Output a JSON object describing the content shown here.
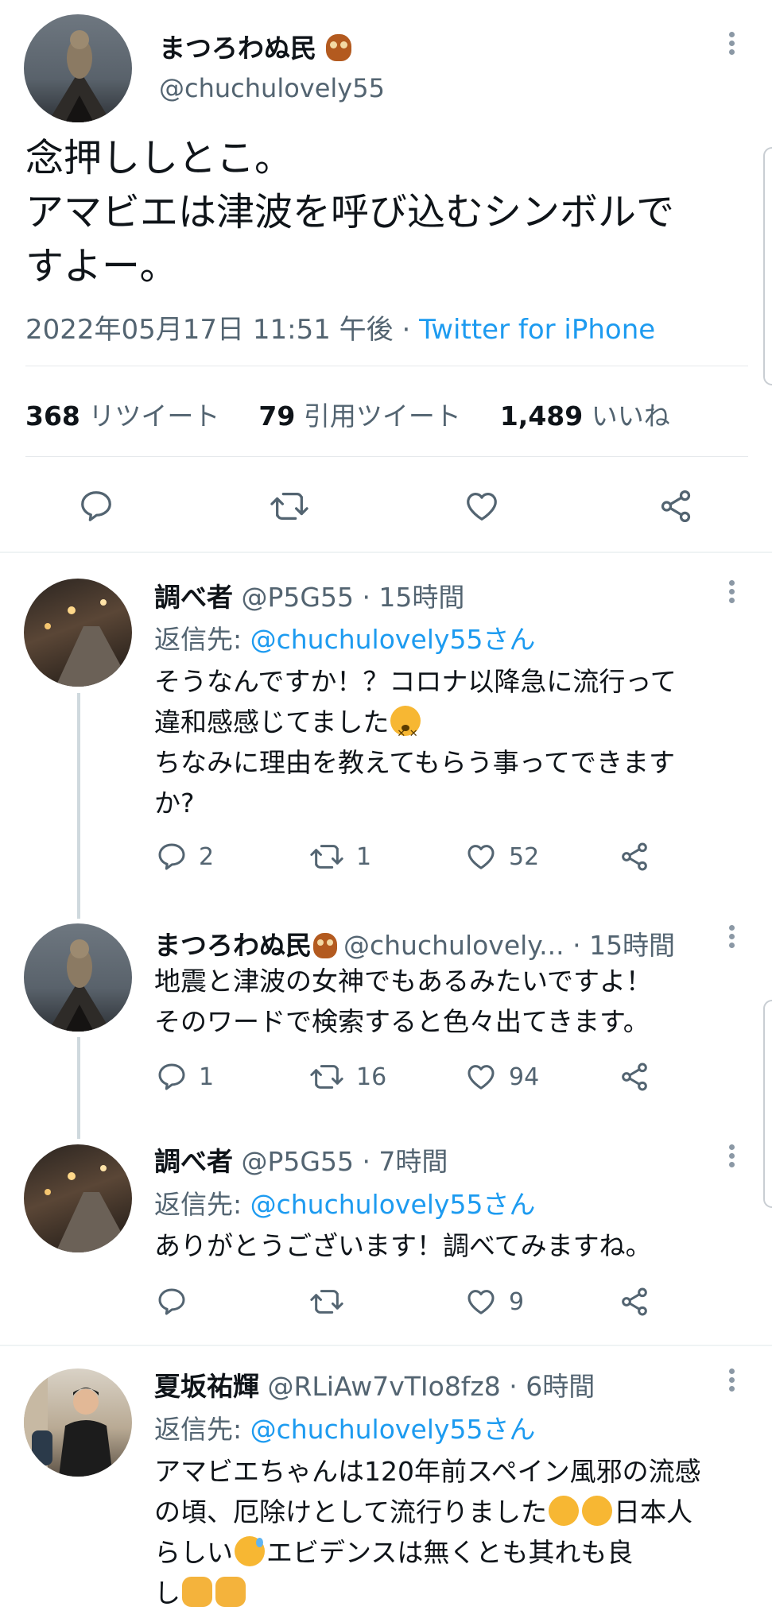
{
  "main_tweet": {
    "display_name": "まつろわぬ民",
    "handle": "@chuchulovely55",
    "text_lines": [
      "念押ししとこ。",
      "アマビエは津波を呼び込むシンボルで",
      "すよー。"
    ],
    "timestamp": "2022年05月17日 11:51 午後",
    "separator": " · ",
    "source": "Twitter for iPhone",
    "stats": {
      "retweets": "368",
      "retweets_label": "リツイート",
      "quotes": "79",
      "quotes_label": "引用ツイート",
      "likes": "1,489",
      "likes_label": "いいね"
    }
  },
  "replies": [
    {
      "display_name": "調べ者",
      "meta": "@P5G55 · 15時間",
      "reply_to_label": "返信先: ",
      "reply_to_handle": "@chuchulovely55さん",
      "text_lines": [
        "そうなんですか！？コロナ以降急に流行って",
        "違和感感じてました",
        "ちなみに理由を教えてもらう事ってできます",
        "か?"
      ],
      "reply_count": "2",
      "retweet_count": "1",
      "like_count": "52"
    },
    {
      "display_name": "まつろわぬ民",
      "meta": "@chuchulovely... · 15時間",
      "text_lines": [
        "地震と津波の女神でもあるみたいですよ！",
        "そのワードで検索すると色々出てきます。"
      ],
      "reply_count": "1",
      "retweet_count": "16",
      "like_count": "94"
    },
    {
      "display_name": "調べ者",
      "meta": "@P5G55 · 7時間",
      "reply_to_label": "返信先: ",
      "reply_to_handle": "@chuchulovely55さん",
      "text_lines": [
        "ありがとうございます！調べてみますね。"
      ],
      "like_count": "9"
    },
    {
      "display_name": "夏坂祐輝",
      "meta": "@RLiAw7vTIo8fz8 · 6時間",
      "reply_to_label": "返信先: ",
      "reply_to_handle": "@chuchulovely55さん",
      "text_lines": [
        "アマビエちゃんは120年前スペイン風邪の流感",
        "の頃、厄除けとして流行りました",
        "日本人",
        "らしい",
        "エビデンスは無くとも其れも良",
        "し"
      ]
    }
  ],
  "colors": {
    "link": "#1d9bf0",
    "muted": "#536471",
    "divider": "#e6e9ec"
  }
}
